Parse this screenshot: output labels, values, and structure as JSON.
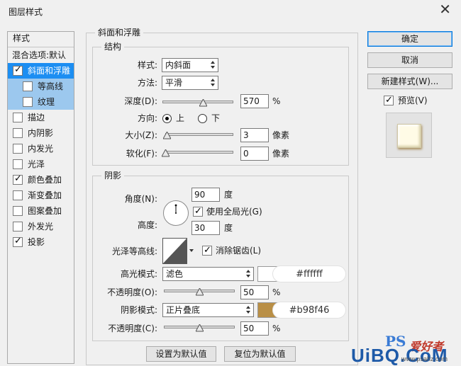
{
  "window": {
    "title": "图层样式"
  },
  "styles_panel": {
    "header": "样式",
    "blend_options": "混合选项:默认",
    "items": [
      {
        "label": "斜面和浮雕",
        "checked": true,
        "selected": true,
        "sub": false
      },
      {
        "label": "等高线",
        "checked": false,
        "selected": false,
        "sub": true
      },
      {
        "label": "纹理",
        "checked": false,
        "selected": false,
        "sub": true
      },
      {
        "label": "描边",
        "checked": false,
        "selected": false,
        "sub": false
      },
      {
        "label": "内阴影",
        "checked": false,
        "selected": false,
        "sub": false
      },
      {
        "label": "内发光",
        "checked": false,
        "selected": false,
        "sub": false
      },
      {
        "label": "光泽",
        "checked": false,
        "selected": false,
        "sub": false
      },
      {
        "label": "颜色叠加",
        "checked": true,
        "selected": false,
        "sub": false
      },
      {
        "label": "渐变叠加",
        "checked": false,
        "selected": false,
        "sub": false
      },
      {
        "label": "图案叠加",
        "checked": false,
        "selected": false,
        "sub": false
      },
      {
        "label": "外发光",
        "checked": false,
        "selected": false,
        "sub": false
      },
      {
        "label": "投影",
        "checked": true,
        "selected": false,
        "sub": false
      }
    ]
  },
  "bevel": {
    "group_title": "斜面和浮雕",
    "structure_title": "结构",
    "style_label": "样式:",
    "style_value": "内斜面",
    "technique_label": "方法:",
    "technique_value": "平滑",
    "depth_label": "深度(D):",
    "depth_value": "570",
    "depth_unit": "%",
    "depth_slider": 0.57,
    "direction_label": "方向:",
    "direction_up": "上",
    "direction_down": "下",
    "direction_selected": "上",
    "size_label": "大小(Z):",
    "size_value": "3",
    "size_unit": "像素",
    "size_slider": 0.02,
    "soften_label": "软化(F):",
    "soften_value": "0",
    "soften_unit": "像素",
    "soften_slider": 0.0
  },
  "shading": {
    "title": "阴影",
    "angle_label": "角度(N):",
    "angle_value": "90",
    "angle_unit": "度",
    "global_light_label": "使用全局光(G)",
    "global_light_checked": true,
    "altitude_label": "高度:",
    "altitude_value": "30",
    "altitude_unit": "度",
    "gloss_contour_label": "光泽等高线:",
    "anti_alias_label": "消除锯齿(L)",
    "anti_alias_checked": true,
    "highlight_mode_label": "高光模式:",
    "highlight_mode_value": "滤色",
    "highlight_color": "#ffffff",
    "highlight_hex": "#ffffff",
    "highlight_opacity_label": "不透明度(O):",
    "highlight_opacity_value": "50",
    "highlight_opacity_unit": "%",
    "highlight_opacity_slider": 0.5,
    "shadow_mode_label": "阴影模式:",
    "shadow_mode_value": "正片叠底",
    "shadow_color": "#b98f46",
    "shadow_hex": "#b98f46",
    "shadow_opacity_label": "不透明度(C):",
    "shadow_opacity_value": "50",
    "shadow_opacity_unit": "%",
    "shadow_opacity_slider": 0.5
  },
  "footer": {
    "set_default": "设置为默认值",
    "reset_default": "复位为默认值"
  },
  "actions": {
    "ok": "确定",
    "cancel": "取消",
    "new_style": "新建样式(W)...",
    "preview_label": "预览(V)",
    "preview_checked": true
  },
  "watermark": {
    "ps": "PS",
    "site_cn": "爱好者",
    "brand": "UiBQ.CoM",
    "url": "www.psahz.com"
  },
  "colors": {
    "selected_bg": "#1c8ef2",
    "sub_bg": "#9cc8ee",
    "accent": "#0a7adb"
  }
}
